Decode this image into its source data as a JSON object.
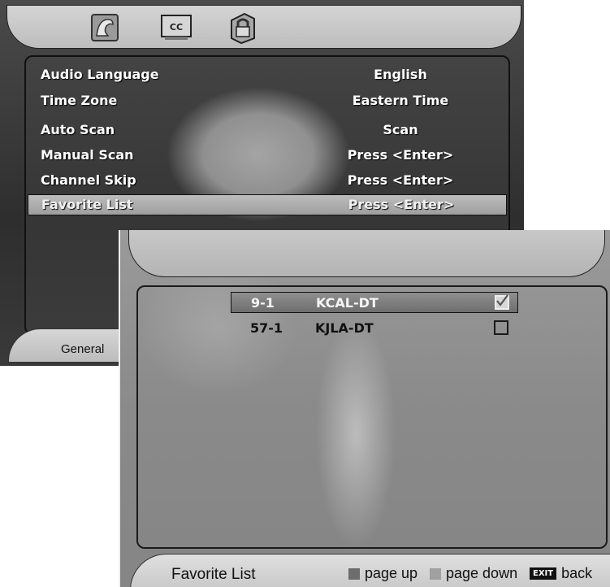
{
  "back_screen": {
    "tabs": [
      {
        "name": "picture-icon"
      },
      {
        "name": "cc-icon",
        "label": "CC"
      },
      {
        "name": "lock-icon"
      }
    ],
    "menu": [
      {
        "label": "Audio Language",
        "value": "English"
      },
      {
        "label": "Time Zone",
        "value": "Eastern Time"
      },
      {
        "label": "Auto Scan",
        "value": "Scan"
      },
      {
        "label": "Manual Scan",
        "value": "Press <Enter>"
      },
      {
        "label": "Channel Skip",
        "value": "Press <Enter>"
      },
      {
        "label": "Favorite List",
        "value": "Press <Enter>",
        "selected": true
      }
    ],
    "bottom_label": "General"
  },
  "front_screen": {
    "channels": [
      {
        "number": "9-1",
        "name": "KCAL-DT",
        "checked": true,
        "selected": true
      },
      {
        "number": "57-1",
        "name": "KJLA-DT",
        "checked": false,
        "selected": false
      }
    ],
    "title": "Favorite List",
    "legend": {
      "page_up": "page up",
      "page_down": "page down",
      "exit_key": "EXIT",
      "back": "back"
    }
  },
  "colors": {
    "highlight": "#9e9e9e",
    "panel_border": "#111111",
    "bar": "#c9c9c9"
  }
}
